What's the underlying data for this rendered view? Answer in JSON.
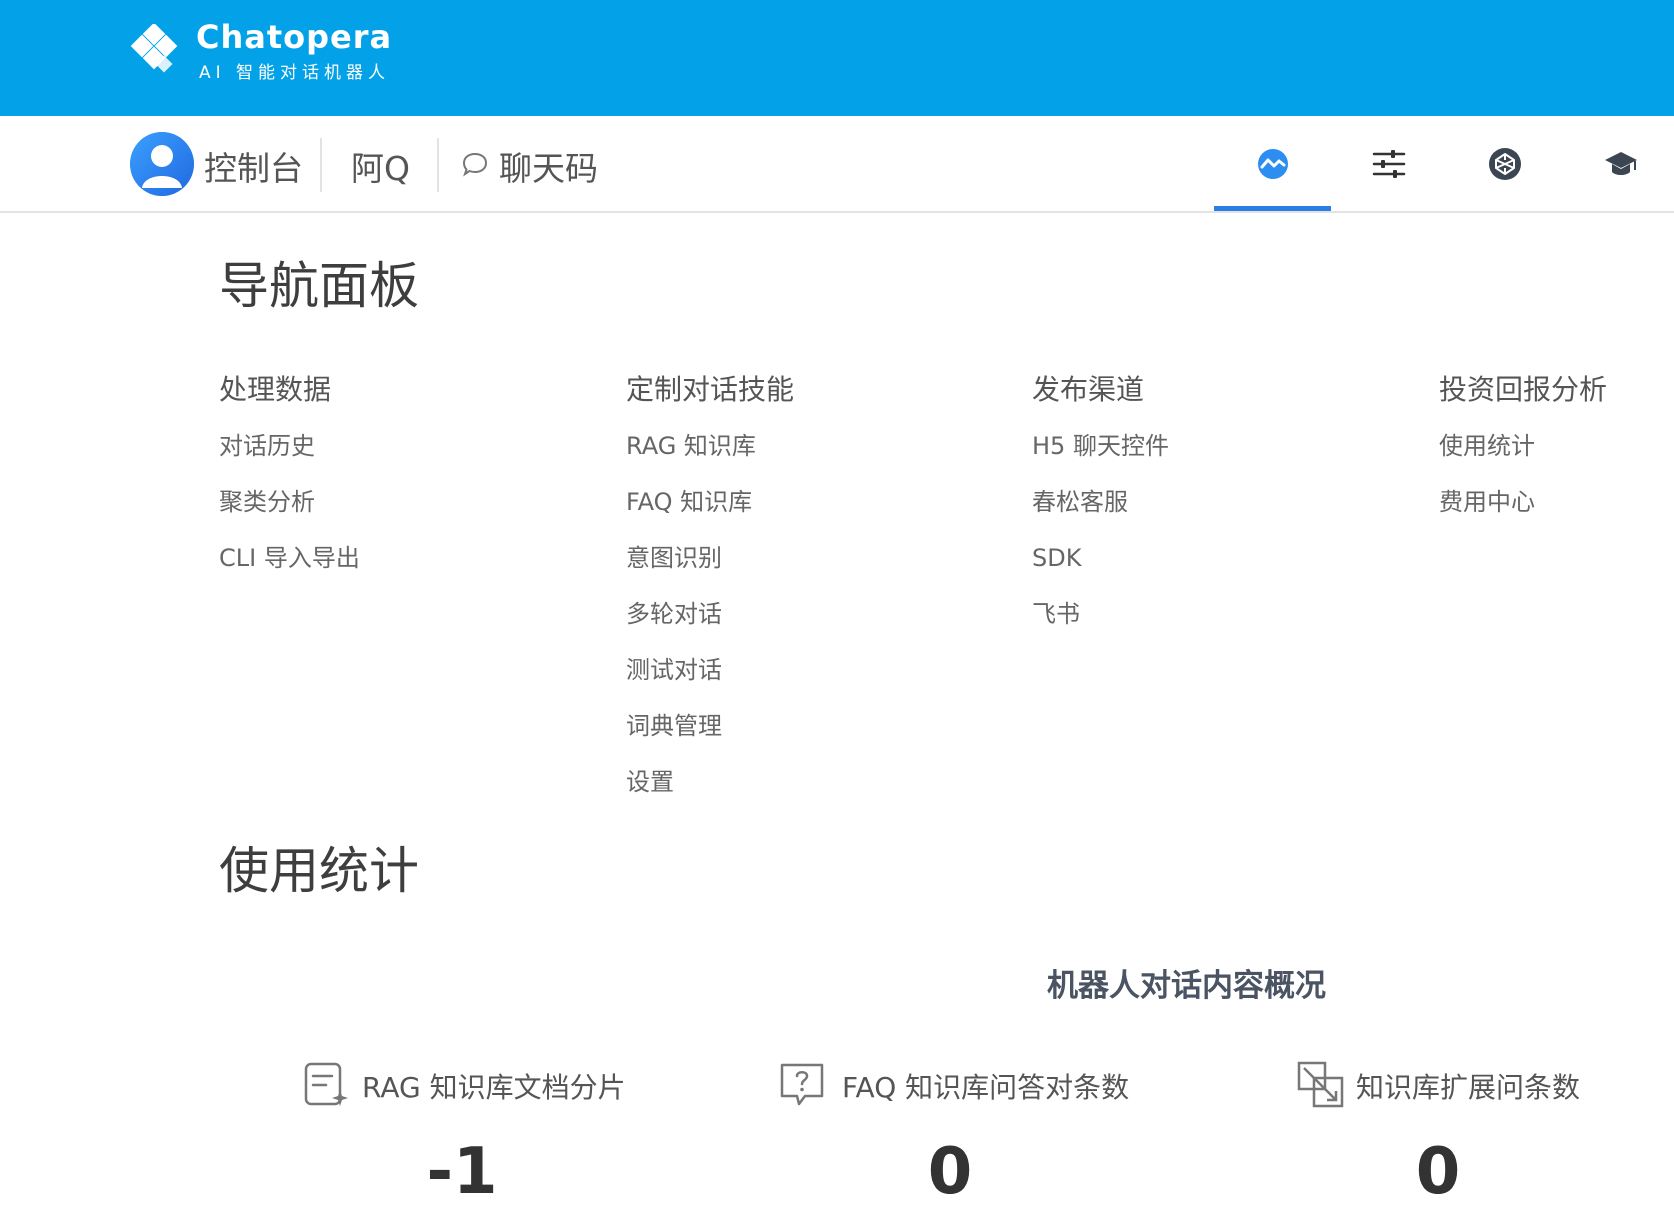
{
  "brand": {
    "name": "Chatopera",
    "tagline": "AI 智能对话机器人",
    "color": "#03a2e8"
  },
  "nav": {
    "console": "控制台",
    "aq": "阿Q",
    "chat_code": "聊天码",
    "icons": [
      "dashboard-icon",
      "sliders-icon",
      "codepen-icon",
      "graduation-cap-icon"
    ],
    "active_color": "#2b7ee5"
  },
  "nav_panel": {
    "title": "导航面板",
    "columns": [
      {
        "heading": "处理数据",
        "items": [
          "对话历史",
          "聚类分析",
          "CLI 导入导出"
        ]
      },
      {
        "heading": "定制对话技能",
        "items": [
          "RAG 知识库",
          "FAQ 知识库",
          "意图识别",
          "多轮对话",
          "测试对话",
          "词典管理",
          "设置"
        ]
      },
      {
        "heading": "发布渠道",
        "items": [
          "H5 聊天控件",
          "春松客服",
          "SDK",
          "飞书"
        ]
      },
      {
        "heading": "投资回报分析",
        "items": [
          "使用统计",
          "费用中心"
        ]
      }
    ]
  },
  "usage": {
    "title": "使用统计",
    "overview_heading": "机器人对话内容概况",
    "stats": [
      {
        "label": "RAG 知识库文档分片",
        "value": "-1",
        "icon": "document-sparkle-icon"
      },
      {
        "label": "FAQ 知识库问答对条数",
        "value": "0",
        "icon": "question-bubble-icon"
      },
      {
        "label": "知识库扩展问条数",
        "value": "0",
        "icon": "expand-squares-icon"
      }
    ]
  }
}
